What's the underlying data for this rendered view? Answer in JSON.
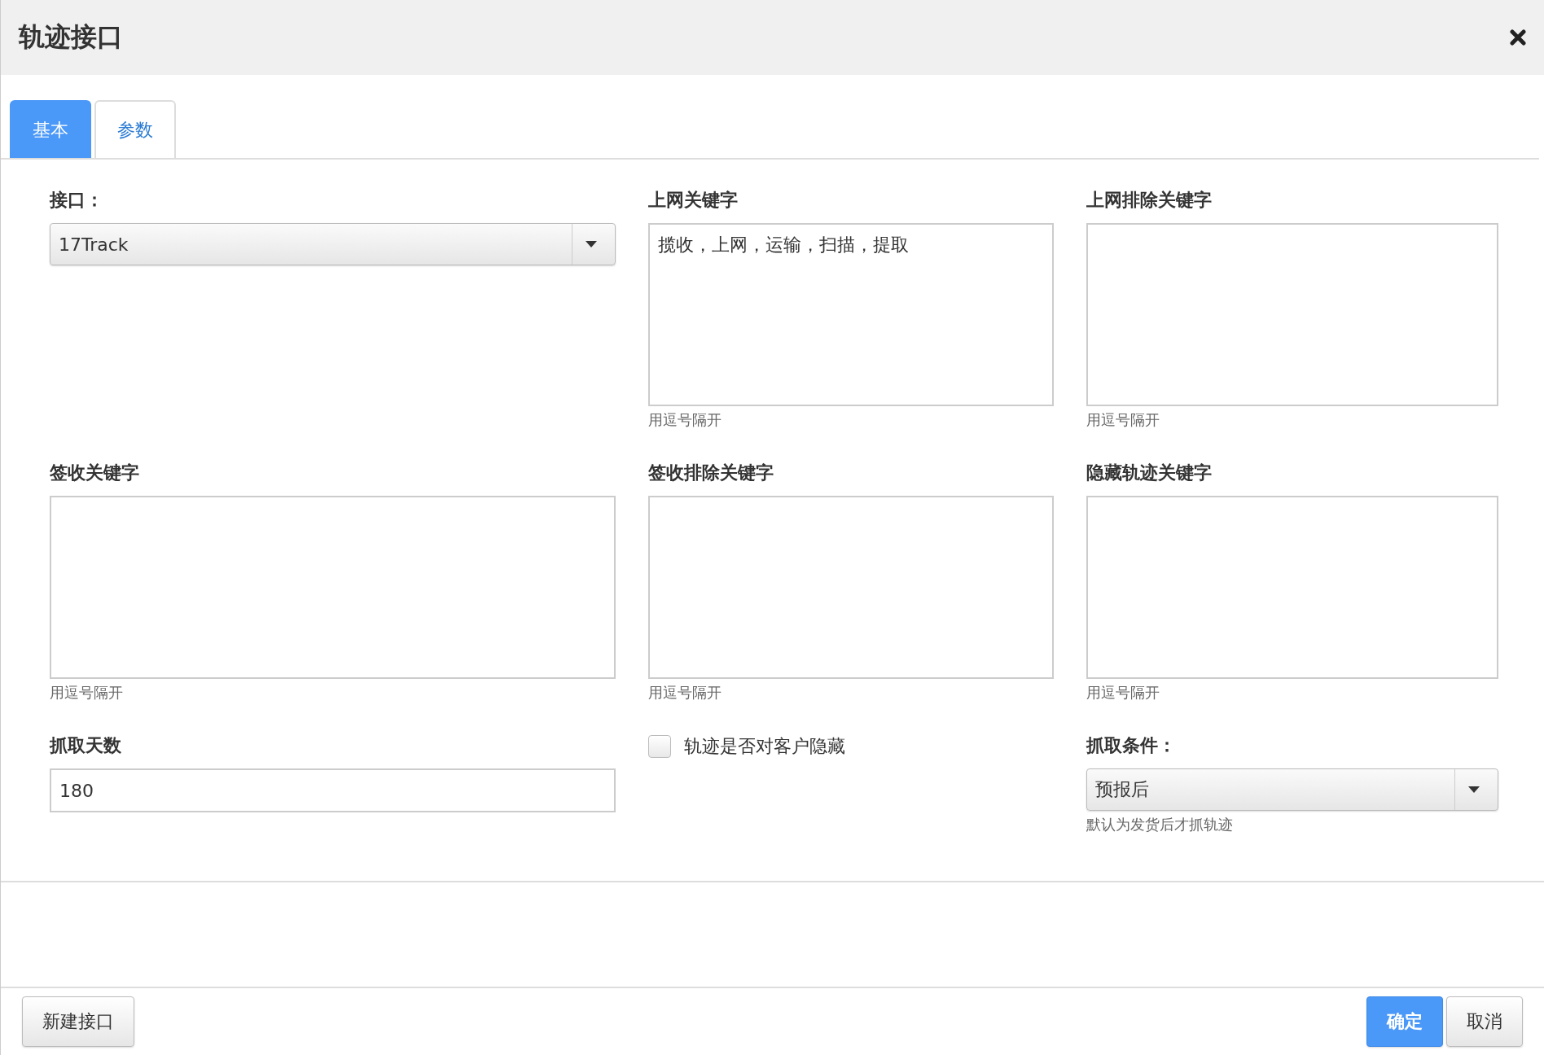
{
  "dialog": {
    "title": "轨迹接口"
  },
  "tabs": [
    {
      "label": "基本",
      "selected": true
    },
    {
      "label": "参数",
      "selected": false
    }
  ],
  "fields": [
    {
      "kind": "select",
      "label": "接口：",
      "value": "17Track"
    },
    {
      "kind": "textarea",
      "label": "上网关键字",
      "value": "揽收，上网，运输，扫描，提取",
      "hint": "用逗号隔开"
    },
    {
      "kind": "textarea",
      "label": "上网排除关键字",
      "hint": "用逗号隔开"
    },
    {
      "kind": "textarea",
      "label": "签收关键字",
      "hint": "用逗号隔开"
    },
    {
      "kind": "textarea",
      "label": "签收排除关键字",
      "hint": "用逗号隔开"
    },
    {
      "kind": "textarea",
      "label": "隐藏轨迹关键字",
      "hint": "用逗号隔开"
    },
    {
      "kind": "text",
      "label": "抓取天数",
      "value": "180"
    },
    {
      "kind": "checkbox",
      "label": "轨迹是否对客户隐藏",
      "checked": false
    },
    {
      "kind": "select",
      "label": "抓取条件：",
      "value": "预报后",
      "hint": "默认为发货后才抓轨迹"
    }
  ],
  "footer": {
    "left": [
      {
        "label": "新建接口",
        "kind": "default"
      }
    ],
    "right": [
      {
        "label": "确定",
        "kind": "primary"
      },
      {
        "label": "取消",
        "kind": "default"
      }
    ]
  }
}
